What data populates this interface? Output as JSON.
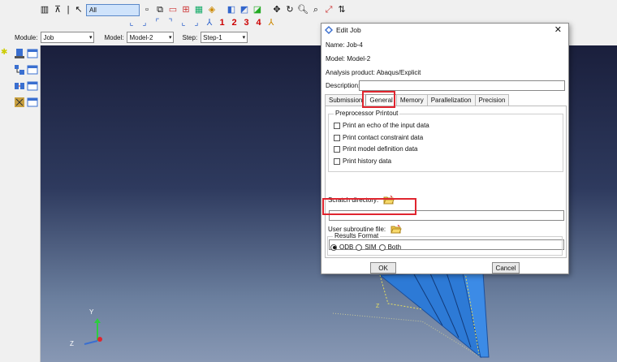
{
  "toolbar": {
    "selection_filter": "All",
    "numbered_buttons": [
      "1",
      "2",
      "3",
      "4"
    ]
  },
  "context_bar": {
    "module_label": "Module:",
    "module_value": "Job",
    "model_label": "Model:",
    "model_value": "Model-2",
    "step_label": "Step:",
    "step_value": "Step-1"
  },
  "viewport": {
    "axis_labels": {
      "y": "Y",
      "z": "Z"
    }
  },
  "dialog": {
    "title": "Edit Job",
    "name_line": "Name:  Job-4",
    "model_line": "Model:  Model-2",
    "analysis_line": "Analysis product:  Abaqus/Explicit",
    "description_label": "Description:",
    "description_value": "",
    "tabs": [
      "Submission",
      "General",
      "Memory",
      "Parallelization",
      "Precision"
    ],
    "active_tab": "General",
    "preprocessor_title": "Preprocessor Printout",
    "checkboxes": [
      "Print an echo of the input data",
      "Print contact constraint data",
      "Print model definition data",
      "Print history data"
    ],
    "scratch_label": "Scratch directory:",
    "scratch_value": "",
    "user_subroutine_label": "User subroutine file:",
    "user_subroutine_value": "",
    "results_title": "Results Format",
    "results_options": [
      "ODB",
      "SIM",
      "Both"
    ],
    "results_selected": "ODB",
    "ok_label": "OK",
    "cancel_label": "Cancel"
  },
  "colors": {
    "highlight": "#e0252f",
    "part_blue": "#2d7ad6",
    "viewport_top": "#1a1f3c",
    "viewport_bottom": "#8898b4"
  }
}
